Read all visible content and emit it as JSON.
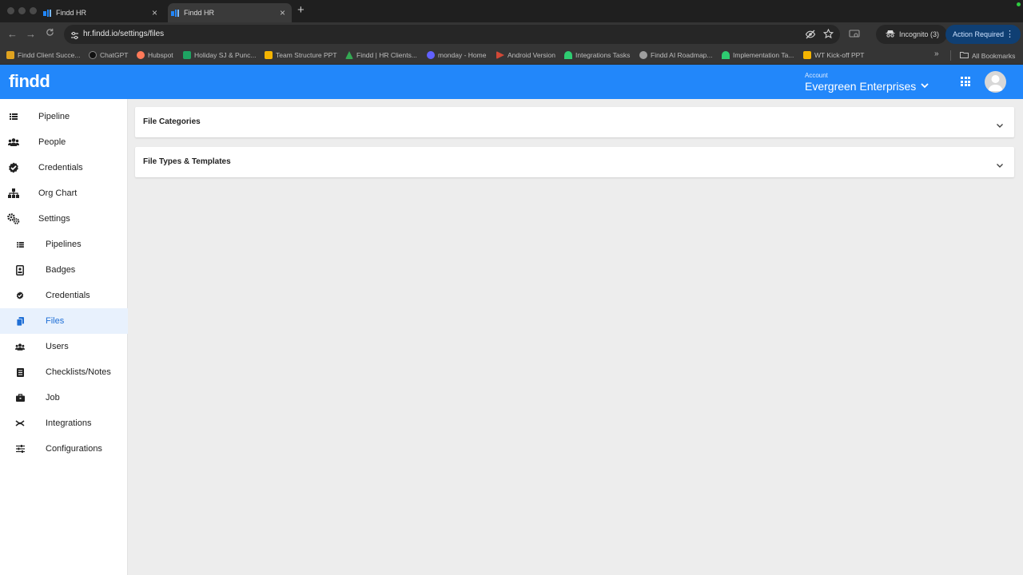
{
  "browser": {
    "tabs": [
      {
        "title": "Findd HR",
        "active": false
      },
      {
        "title": "Findd HR",
        "active": true
      }
    ],
    "url": "hr.findd.io/settings/files",
    "incognito_label": "Incognito (3)",
    "action_required_label": "Action Required",
    "bookmarks": [
      {
        "label": "Findd Client Succe...",
        "icon_color": "#e0a31f"
      },
      {
        "label": "ChatGPT",
        "icon_color": "#2b2b2b"
      },
      {
        "label": "Hubspot",
        "icon_color": "#ff7a59"
      },
      {
        "label": "Holiday SJ & Punc...",
        "icon_color": "#1ea362"
      },
      {
        "label": "Team Structure PPT",
        "icon_color": "#f4b400"
      },
      {
        "label": "Findd | HR Clients...",
        "icon_color": "#34a853"
      },
      {
        "label": "monday - Home",
        "icon_color": "#6161ff"
      },
      {
        "label": "Android Version",
        "icon_color": "#d14836"
      },
      {
        "label": "Integrations Tasks",
        "icon_color": "#2ecc71"
      },
      {
        "label": "Findd AI Roadmap...",
        "icon_color": "#9e9e9e"
      },
      {
        "label": "Implementation Ta...",
        "icon_color": "#2ecc71"
      },
      {
        "label": "WT Kick-off PPT",
        "icon_color": "#f4b400"
      }
    ],
    "all_bookmarks_label": "All Bookmarks"
  },
  "app": {
    "logo_text": "findd",
    "account_label": "Account",
    "account_name": "Evergreen Enterprises",
    "brand_color": "#2287fa"
  },
  "sidebar": {
    "top_items": [
      {
        "label": "Pipeline",
        "icon": "list-icon"
      },
      {
        "label": "People",
        "icon": "people-icon"
      },
      {
        "label": "Credentials",
        "icon": "check-circle-icon"
      },
      {
        "label": "Org Chart",
        "icon": "org-chart-icon"
      },
      {
        "label": "Settings",
        "icon": "gears-icon"
      }
    ],
    "sub_items": [
      {
        "label": "Pipelines",
        "icon": "list-icon"
      },
      {
        "label": "Badges",
        "icon": "badge-icon"
      },
      {
        "label": "Credentials",
        "icon": "check-circle-icon"
      },
      {
        "label": "Files",
        "icon": "files-icon",
        "active": true
      },
      {
        "label": "Users",
        "icon": "users-icon"
      },
      {
        "label": "Checklists/Notes",
        "icon": "checklist-icon"
      },
      {
        "label": "Job",
        "icon": "briefcase-icon"
      },
      {
        "label": "Integrations",
        "icon": "integrations-icon"
      },
      {
        "label": "Configurations",
        "icon": "sliders-icon"
      }
    ]
  },
  "main": {
    "panels": [
      {
        "title": "File Categories"
      },
      {
        "title": "File Types & Templates"
      }
    ]
  }
}
